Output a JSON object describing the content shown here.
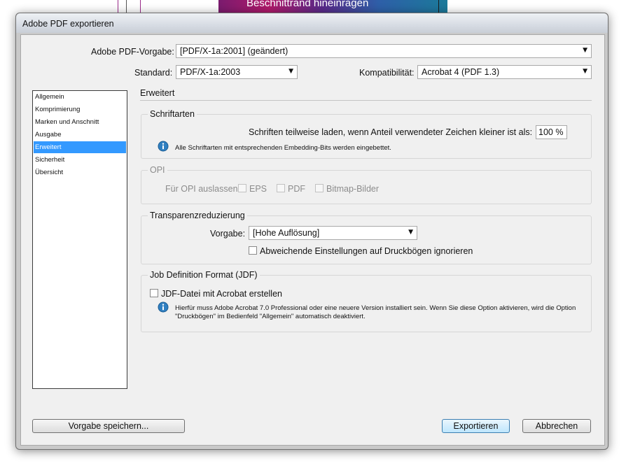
{
  "background": {
    "overlay_text": "Beschnittrand hineinragen"
  },
  "window": {
    "title": "Adobe PDF exportieren"
  },
  "top": {
    "preset_label": "Adobe PDF-Vorgabe:",
    "preset_value": "[PDF/X-1a:2001] (geändert)",
    "standard_label": "Standard:",
    "standard_value": "PDF/X-1a:2003",
    "compat_label": "Kompatibilität:",
    "compat_value": "Acrobat 4 (PDF 1.3)"
  },
  "sidebar": {
    "items": [
      {
        "label": "Allgemein",
        "selected": false
      },
      {
        "label": "Komprimierung",
        "selected": false
      },
      {
        "label": "Marken und Anschnitt",
        "selected": false
      },
      {
        "label": "Ausgabe",
        "selected": false
      },
      {
        "label": "Erweitert",
        "selected": true
      },
      {
        "label": "Sicherheit",
        "selected": false
      },
      {
        "label": "Übersicht",
        "selected": false
      }
    ]
  },
  "panel": {
    "title": "Erweitert",
    "fonts": {
      "title": "Schriftarten",
      "subset_label": "Schriften teilweise laden, wenn Anteil verwendeter Zeichen kleiner ist als:",
      "subset_value": "100 %",
      "info_text": "Alle Schriftarten mit entsprechenden Embedding-Bits werden eingebettet."
    },
    "opi": {
      "title": "OPI",
      "omit_label": "Für OPI auslassen:",
      "options": [
        "EPS",
        "PDF",
        "Bitmap-Bilder"
      ]
    },
    "transparency": {
      "title": "Transparenzreduzierung",
      "preset_label": "Vorgabe:",
      "preset_value": "[Hohe Auflösung]",
      "ignore_label": "Abweichende Einstellungen auf Druckbögen ignorieren"
    },
    "jdf": {
      "title": "Job Definition Format (JDF)",
      "create_label": "JDF-Datei mit Acrobat erstellen",
      "info_line1": "Hierfür muss Adobe Acrobat 7.0 Professional oder eine neuere Version installiert sein. Wenn Sie diese Option aktivieren, wird die Option",
      "info_line2": "\"Druckbögen\" im Bedienfeld \"Allgemein\" automatisch deaktiviert."
    }
  },
  "buttons": {
    "save_preset": "Vorgabe speichern...",
    "export": "Exportieren",
    "cancel": "Abbrechen"
  },
  "colors": {
    "selection": "#3399ff",
    "dialog_bg": "#f0f0f0",
    "info_icon": "#2f7fc1"
  },
  "icons": {
    "dropdown": "chevron-down-icon",
    "info": "info-icon"
  }
}
